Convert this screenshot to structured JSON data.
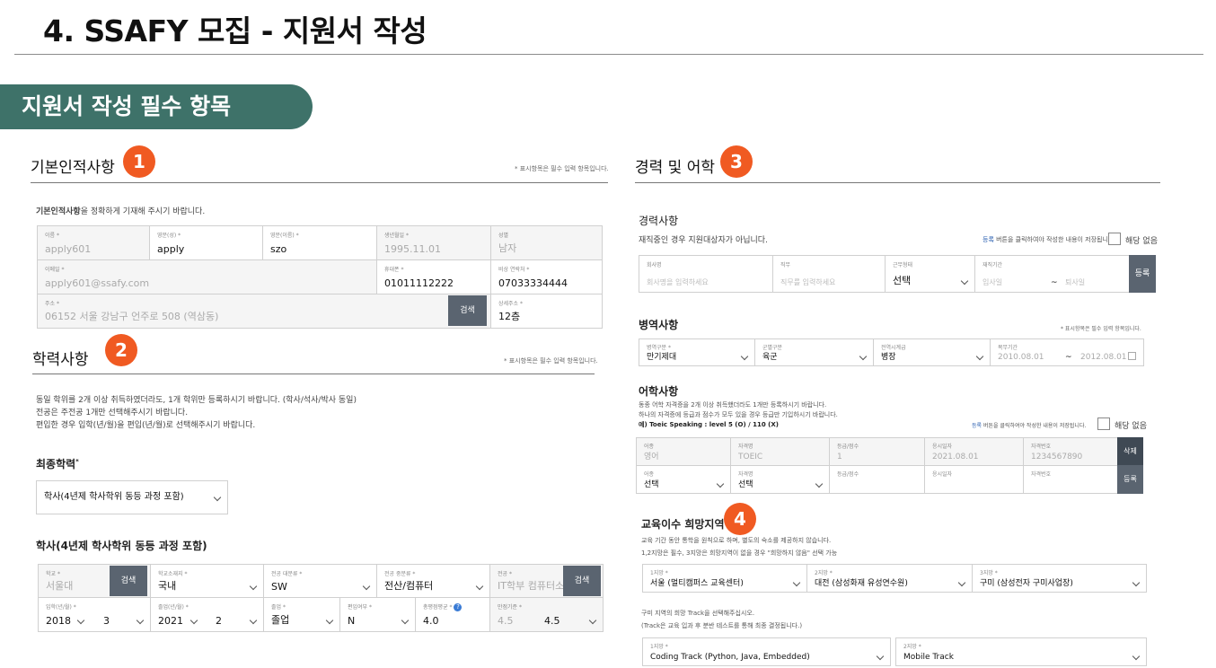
{
  "slide": {
    "title": "4. SSAFY 모집 - 지원서 작성",
    "banner": "지원서 작성 필수 항목"
  },
  "basic": {
    "title": "기본인적사항",
    "badge": "1",
    "req_note": "* 표시항목은 필수 입력 항목입니다.",
    "desc_bold": "기본인적사항",
    "desc_rest": "을 정확하게 기재해 주시기 바랍니다.",
    "id_label": "이름 *",
    "id_value": "apply601",
    "lastname_label": "영문(성) *",
    "lastname_value": "apply",
    "firstname_label": "영문(이름) *",
    "firstname_value": "szo",
    "birth_label": "생년월일 *",
    "birth_value": "1995.11.01",
    "gender_label": "성별",
    "gender_value": "남자",
    "email_label": "이메일 *",
    "email_value": "apply601@ssafy.com",
    "phone_label": "휴대폰 *",
    "phone_value": "01011112222",
    "emergency_label": "비상 연락처 *",
    "emergency_value": "07033334444",
    "address_label": "주소 *",
    "address_value": "06152 서울 강남구 언주로 508 (역삼동)",
    "search_btn": "검색",
    "detail_label": "상세주소 *",
    "detail_value": "12층"
  },
  "edu": {
    "title": "학력사항",
    "badge": "2",
    "req_note": "* 표시항목은 필수 입력 항목입니다.",
    "notes": [
      "동일 학위를 2개 이상 취득하였더라도, 1개 학위만 등록하시기 바랍니다. (학사/석사/박사 동일)",
      "전공은 주전공 1개만 선택해주시기 바랍니다.",
      "편입한 경우 입학(년/월)을 편입(년/월)로 선택해주시기 바랍니다."
    ],
    "final_label": "최종학력",
    "final_star": "*",
    "final_select": "학사(4년제 학사학위 동등 과정 포함)",
    "degree_title": "학사(4년제 학사학위 동등 과정 포함)",
    "school_label": "학교 *",
    "school_value": "서울대",
    "search_btn": "검색",
    "loc_label": "학교소재지 *",
    "loc_value": "국내",
    "major_cat_label": "전공 대분류 *",
    "major_cat_value": "SW",
    "major_mid_label": "전공 중분류 *",
    "major_mid_value": "전산/컴퓨터",
    "major_label": "전공 *",
    "major_value": "IT학부 컴퓨터소",
    "admit_label": "입학(년/월) *",
    "admit_year": "2018",
    "admit_month": "3",
    "grad_label": "졸업(년/월) *",
    "grad_year": "2021",
    "grad_month": "2",
    "status_label": "졸업 *",
    "status_value": "졸업",
    "transfer_label": "편입여부 *",
    "transfer_value": "N",
    "gpa_label": "총평점평균 *",
    "gpa_info": "?",
    "gpa_value": "4.0",
    "scale_label": "만점기준 *",
    "scale_dim": "4.5",
    "scale_value": "4.5"
  },
  "career": {
    "title": "경력 및 어학",
    "badge": "3",
    "exp_title": "경력사항",
    "exp_note": "재직중인 경우 지원대상자가 아닙니다.",
    "link_word": "등록",
    "link_rest": " 버튼을 클릭하여야 작성한 내용이 저장됩니다.",
    "na_label": "해당 없음",
    "company_label": "회사명",
    "company_ph": "회사명을 입력하세요",
    "duty_label": "직무",
    "duty_ph": "직무를 입력하세요",
    "worktype_label": "근무형태",
    "worktype_value": "선택",
    "period_label": "재직기간",
    "start_ph": "입사일",
    "tilde": "~",
    "end_ph": "퇴사일",
    "register_btn": "등록",
    "mil_title": "병역사항",
    "mil_req": "* 표시항목은 필수 입력 항목입니다.",
    "mil_type_label": "병역구분 *",
    "mil_type_value": "만기제대",
    "branch_label": "군별구분",
    "branch_value": "육군",
    "rank_label": "전역시계급",
    "rank_value": "병장",
    "service_label": "복무기간",
    "service_start": "2010.08.01",
    "service_end": "2012.08.01",
    "lang_title": "어학사항",
    "lang_note1": "동종 어학 자격증을 2개 이상 취득했더라도 1개만 등록하시기 바랍니다.",
    "lang_note2": "하나의 자격증에 등급과 점수가 모두 있을 경우 등급만 기입하시기 바랍니다.",
    "lang_note3": "예) Toeic Speaking : level 5 (O) / 110 (X)",
    "lang_label": "어종",
    "lang_value": "영어",
    "cert_label": "자격명",
    "cert_value": "TOEIC",
    "grade_label": "등급/점수",
    "grade_value": "1",
    "date_label": "응시일자",
    "date_value": "2021.08.01",
    "certno_label": "자격번호",
    "certno_value": "1234567890",
    "delete_btn": "삭제",
    "lang_sel": "선택",
    "cert_sel": "선택"
  },
  "region": {
    "title": "교육이수 희망지역",
    "badge": "4",
    "note1": "교육 기간 동안 통학을 원칙으로 하며, 별도의 숙소를 제공하지 않습니다.",
    "note2": "1,2지망은 필수, 3지망은 희망지역이 없을 경우 \"희망하지 않음\" 선택 가능",
    "c1_label": "1지망 *",
    "c1_value": "서울 (멀티캠퍼스 교육센터)",
    "c2_label": "2지망 *",
    "c2_value": "대전 (삼성화재 유성연수원)",
    "c3_label": "3지망 *",
    "c3_value": "구미 (삼성전자 구미사업장)",
    "track_note1": "구미 지역의 희망 Track을 선택해주십시오.",
    "track_note2": "(Track은 교육 입과 후 분반 테스트를 통해 최종 결정됩니다.)",
    "t1_label": "1지망 *",
    "t1_value": "Coding Track (Python, Java, Embedded)",
    "t2_label": "2지망 *",
    "t2_value": "Mobile Track"
  }
}
